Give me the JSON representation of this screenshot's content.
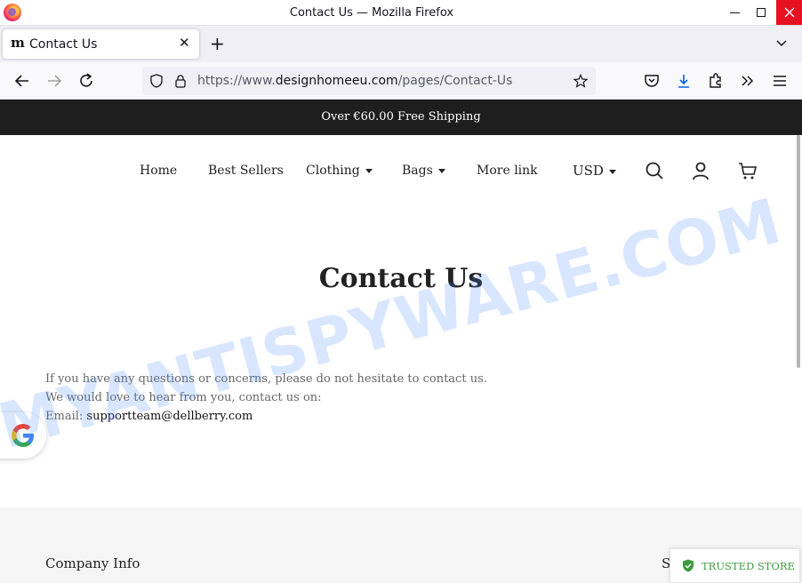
{
  "window": {
    "title": "Contact Us — Mozilla Firefox"
  },
  "tab": {
    "label": "Contact Us",
    "favicon": "m"
  },
  "urlbar": {
    "url_prefix": "https://www.",
    "url_domain": "designhomeeu.com",
    "url_path": "/pages/Contact-Us"
  },
  "site": {
    "announcement": "Over €60.00 Free Shipping",
    "nav": {
      "home": "Home",
      "best_sellers": "Best Sellers",
      "clothing": "Clothing",
      "bags": "Bags",
      "more_link": "More link",
      "currency": "USD"
    },
    "page_title": "Contact Us",
    "body": {
      "line1": "If you have any questions or concerns, please do not hesitate to contact us.",
      "line2": "We would love to hear from you, contact us on:",
      "email_label": "Email:",
      "email": "supportteam@dellberry.com"
    },
    "footer": {
      "company_info": "Company Info",
      "col2_partial": "S"
    },
    "trust_badge": "TRUSTED STORE"
  },
  "watermark": "MYANTISPYWARE.COM",
  "colors": {
    "announce_bg": "#1e1e1e",
    "trusted_green": "#3c9b3f",
    "close_red": "#e81123",
    "download_blue": "#0061e0"
  }
}
